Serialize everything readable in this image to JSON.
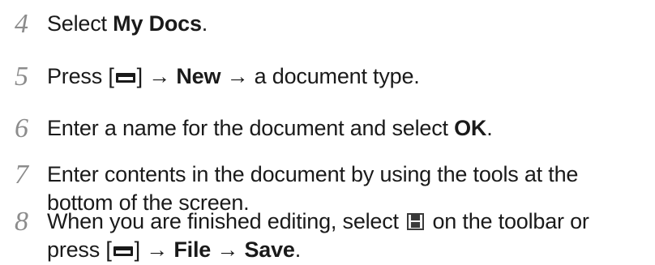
{
  "steps": [
    {
      "number": "4",
      "before": "Select ",
      "bold": "My Docs",
      "after": "."
    },
    {
      "number": "5",
      "press": "Press [",
      "close_bracket": "] → ",
      "new": "New",
      "rest": " → a document type."
    },
    {
      "number": "6",
      "before": "Enter a name for the document and select ",
      "bold": "OK",
      "after": "."
    },
    {
      "number": "7",
      "line1": "Enter contents in the document by using the tools at the",
      "line2": "bottom of the screen."
    },
    {
      "number": "8",
      "line1_before": "When you are finished editing, select ",
      "line1_after": " on the toolbar or",
      "press": "press [",
      "close_bracket": "] → ",
      "file": "File",
      "arrow": " → ",
      "save": "Save",
      "end": "."
    }
  ],
  "icons": {
    "menu_key": "menu-key-icon",
    "save": "save-icon"
  }
}
